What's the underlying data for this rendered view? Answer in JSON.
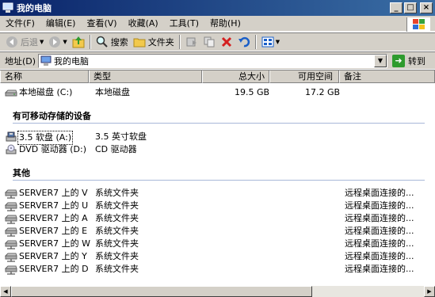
{
  "window": {
    "title": "我的电脑",
    "btn_min": "_",
    "btn_max": "□",
    "btn_close": "×"
  },
  "menu": [
    "文件(F)",
    "编辑(E)",
    "查看(V)",
    "收藏(A)",
    "工具(T)",
    "帮助(H)"
  ],
  "toolbar": {
    "back": "后退",
    "search": "搜索",
    "folders": "文件夹"
  },
  "address": {
    "label": "地址(D)",
    "value": "我的电脑",
    "go": "转到"
  },
  "columns": [
    "名称",
    "类型",
    "总大小",
    "可用空间",
    "备注"
  ],
  "disk": {
    "name": "本地磁盘 (C:)",
    "type": "本地磁盘",
    "total": "19.5 GB",
    "free": "17.2 GB"
  },
  "removable_group": "有可移动存储的设备",
  "removable": [
    {
      "name": "3.5 软盘 (A:)",
      "type": "3.5 英寸软盘"
    },
    {
      "name": "DVD 驱动器 (D:)",
      "type": "CD 驱动器"
    }
  ],
  "other_group": "其他",
  "others": [
    {
      "name": "SERVER7 上的 V",
      "type": "系统文件夹",
      "comment": "远程桌面连接的..."
    },
    {
      "name": "SERVER7 上的 U",
      "type": "系统文件夹",
      "comment": "远程桌面连接的..."
    },
    {
      "name": "SERVER7 上的 A",
      "type": "系统文件夹",
      "comment": "远程桌面连接的..."
    },
    {
      "name": "SERVER7 上的 E",
      "type": "系统文件夹",
      "comment": "远程桌面连接的..."
    },
    {
      "name": "SERVER7 上的 W",
      "type": "系统文件夹",
      "comment": "远程桌面连接的..."
    },
    {
      "name": "SERVER7 上的 Y",
      "type": "系统文件夹",
      "comment": "远程桌面连接的..."
    },
    {
      "name": "SERVER7 上的 D",
      "type": "系统文件夹",
      "comment": "远程桌面连接的..."
    }
  ]
}
